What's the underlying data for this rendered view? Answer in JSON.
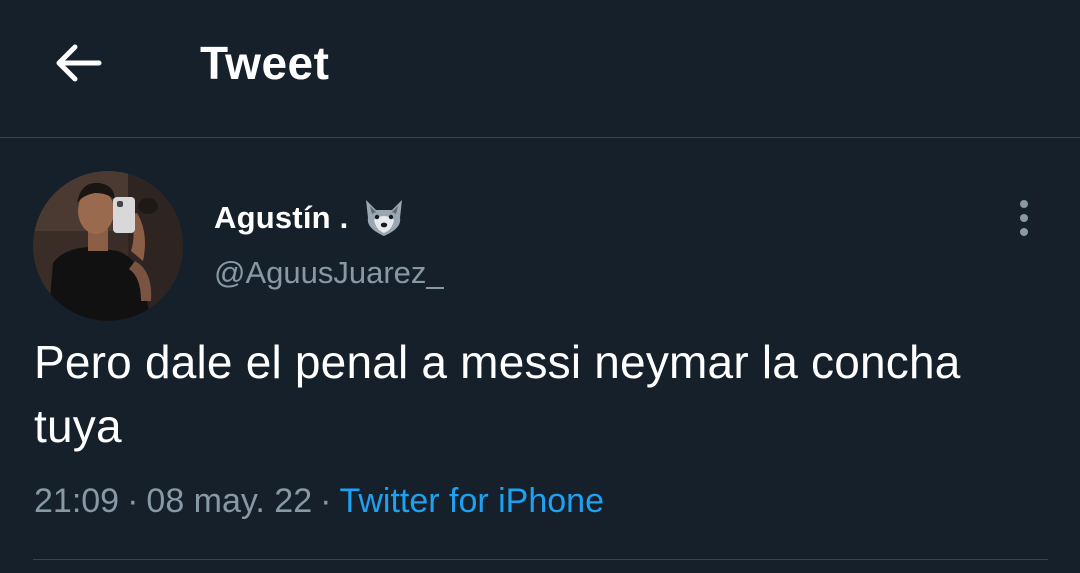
{
  "header": {
    "title": "Tweet",
    "back_icon": "arrow-left-icon"
  },
  "tweet": {
    "author": {
      "display_name": "Agustín .",
      "emoji": "wolf-face-icon",
      "handle": "@AguusJuarez_"
    },
    "more_icon": "more-vertical-icon",
    "text": "Pero dale el penal a messi neymar la concha tuya",
    "meta": {
      "time": "21:09",
      "separator": "·",
      "date": "08 may. 22",
      "source": "Twitter for iPhone"
    }
  },
  "colors": {
    "background": "#15202b",
    "divider": "#38444d",
    "secondary_text": "#8899a6",
    "link": "#1da1f2"
  }
}
